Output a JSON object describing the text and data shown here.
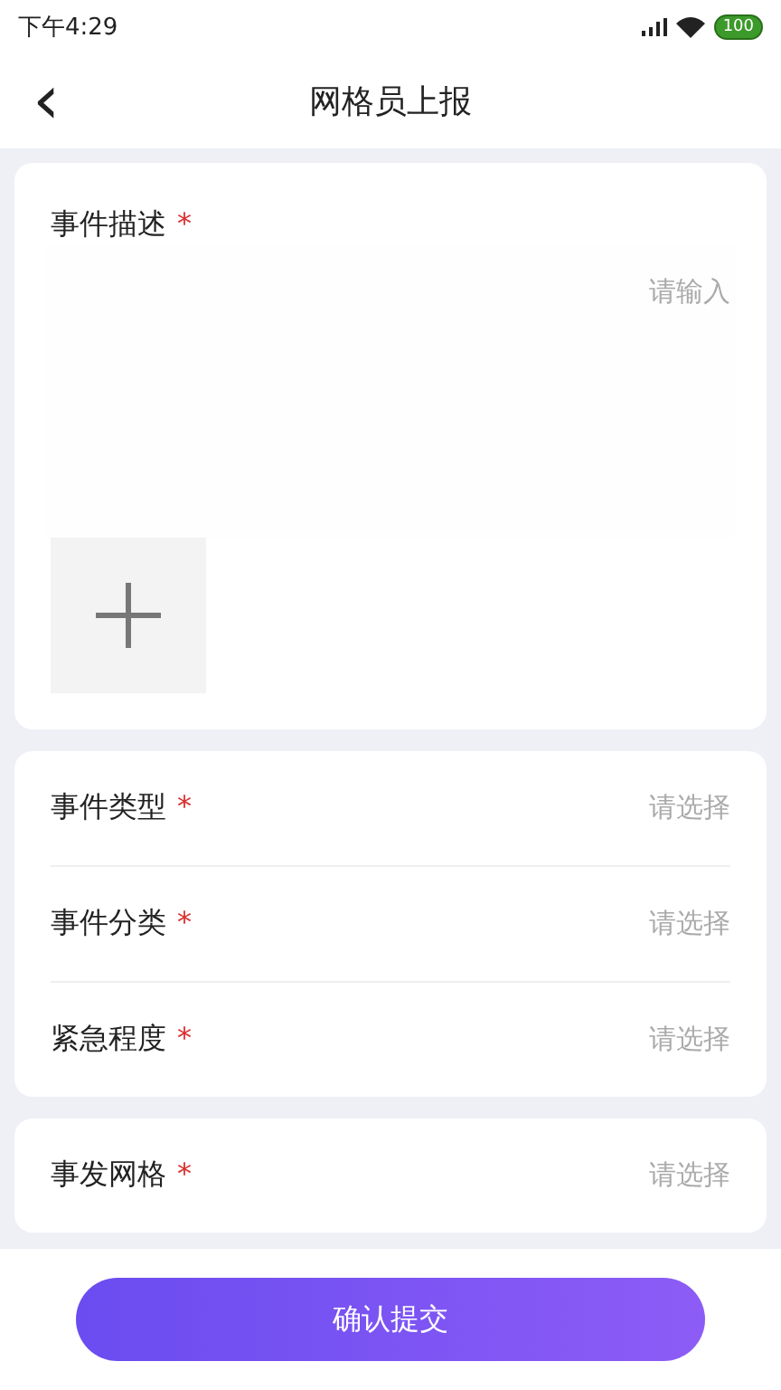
{
  "status_bar": {
    "time": "下午4:29",
    "battery": "100"
  },
  "nav": {
    "back": "‹",
    "title": "网格员上报"
  },
  "description": {
    "label": "事件描述",
    "required": "*",
    "placeholder": "请输入"
  },
  "sections": [
    {
      "rows": [
        {
          "label": "事件类型",
          "required": "*",
          "value": "请选择"
        },
        {
          "label": "事件分类",
          "required": "*",
          "value": "请选择"
        },
        {
          "label": "紧急程度",
          "required": "*",
          "value": "请选择"
        }
      ]
    },
    {
      "rows": [
        {
          "label": "事发网格",
          "required": "*",
          "value": "请选择"
        }
      ]
    }
  ],
  "submit": "确认提交"
}
